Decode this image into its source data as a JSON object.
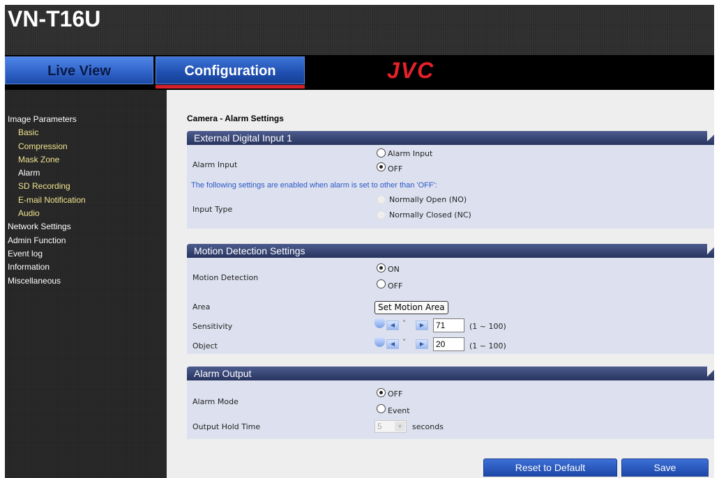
{
  "header": {
    "model": "VN-T16U",
    "brand": "JVC"
  },
  "nav": {
    "live_view": "Live View",
    "configuration": "Configuration"
  },
  "sidebar": {
    "items": [
      {
        "label": "Image Parameters"
      },
      {
        "label": "Basic"
      },
      {
        "label": "Compression"
      },
      {
        "label": "Mask Zone"
      },
      {
        "label": "Alarm"
      },
      {
        "label": "SD Recording"
      },
      {
        "label": "E-mail Notification"
      },
      {
        "label": "Audio"
      },
      {
        "label": "Network Settings"
      },
      {
        "label": "Admin Function"
      },
      {
        "label": "Event log"
      },
      {
        "label": "Information"
      },
      {
        "label": "Miscellaneous"
      }
    ]
  },
  "page": {
    "title": "Camera - Alarm Settings"
  },
  "external_input": {
    "heading": "External Digital Input 1",
    "alarm_input_label": "Alarm Input",
    "option_alarm_input": "Alarm Input",
    "option_off": "OFF",
    "selected": "OFF",
    "note": "The following settings are enabled when alarm is set to other than 'OFF':",
    "input_type_label": "Input Type",
    "option_no": "Normally Open (NO)",
    "option_nc": "Normally Closed (NC)"
  },
  "motion": {
    "heading": "Motion Detection Settings",
    "motion_label": "Motion Detection",
    "option_on": "ON",
    "option_off": "OFF",
    "selected": "ON",
    "area_label": "Area",
    "area_button": "Set Motion Area",
    "sensitivity_label": "Sensitivity",
    "sensitivity_value": "71",
    "sensitivity_range": "(1 ~ 100)",
    "object_label": "Object",
    "object_value": "20",
    "object_range": "(1 ~ 100)"
  },
  "alarm_output": {
    "heading": "Alarm Output",
    "mode_label": "Alarm Mode",
    "option_off": "OFF",
    "option_event": "Event",
    "selected": "OFF",
    "hold_label": "Output Hold Time",
    "hold_value": "5",
    "hold_unit": "seconds"
  },
  "footer": {
    "reset": "Reset to Default",
    "save": "Save"
  },
  "colors": {
    "accent": "#1f4fb0",
    "brand_red": "#e8202a",
    "highlight": "#f2e690"
  }
}
